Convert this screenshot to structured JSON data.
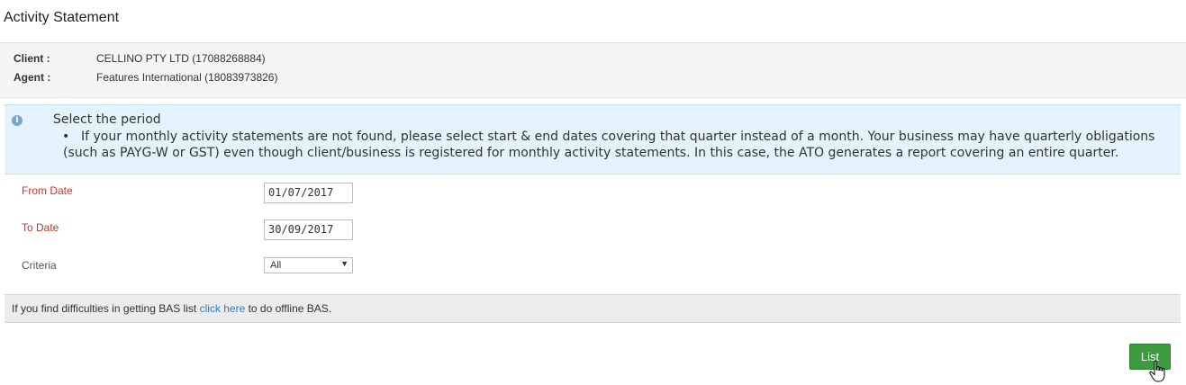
{
  "page": {
    "title": "Activity Statement"
  },
  "client_info": {
    "client_label": "Client :",
    "client_value": "CELLINO PTY LTD (17088268884)",
    "agent_label": "Agent :",
    "agent_value": "Features International (18083973826)"
  },
  "notice": {
    "icon": "info-icon",
    "title": "Select the period",
    "body": "If your monthly activity statements are not found, please select start & end dates covering that quarter instead of a month. Your business may have quarterly obligations (such as PAYG-W or GST) even though client/business is registered for monthly activity statements. In this case, the ATO generates a report covering an entire quarter."
  },
  "form": {
    "from_date_label": "From Date",
    "from_date_value": "01/07/2017",
    "to_date_label": "To Date",
    "to_date_value": "30/09/2017",
    "criteria_label": "Criteria",
    "criteria_value": "All"
  },
  "help": {
    "prefix": "If you find difficulties in getting BAS list",
    "link": "click here",
    "suffix": "to do offline BAS."
  },
  "actions": {
    "list_label": "List"
  },
  "colors": {
    "required_label": "#c0392b",
    "notice_bg": "#e3f2fb",
    "link": "#2a7ec9",
    "button_bg": "#3c9a3f"
  }
}
